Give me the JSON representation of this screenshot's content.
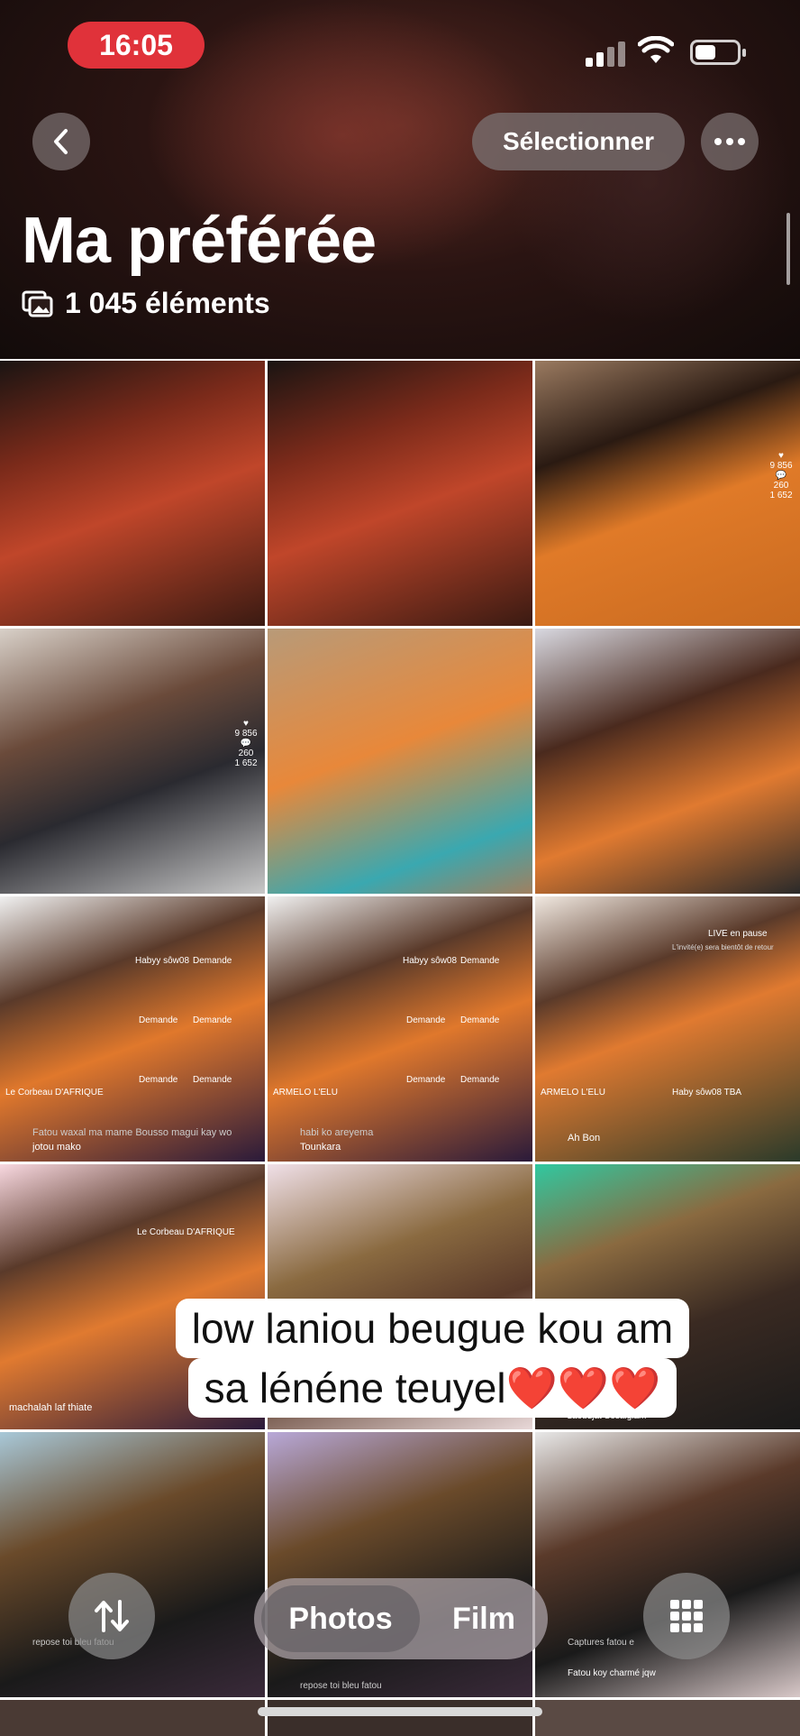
{
  "status_bar": {
    "time": "16:05"
  },
  "nav": {
    "back_icon": "chevron-left-icon",
    "select_label": "Sélectionner",
    "more_icon": "ellipsis-icon"
  },
  "album": {
    "title": "Ma préférée",
    "count_label": "1 045 éléments",
    "count_icon": "photos-stack-icon"
  },
  "grid": {
    "cells": [
      {
        "bg": "linear-gradient(160deg,#1a1412 0%,#7a2a1a 30%,#c0462a 55%,#3a1a12 100%)",
        "labels": []
      },
      {
        "bg": "linear-gradient(160deg,#1a1412 0%,#7a2a1a 30%,#c0462a 55%,#3a1a12 100%)",
        "labels": []
      },
      {
        "bg": "linear-gradient(160deg,#9a7a60 0%,#2a1a12 30%,#e07a28 55%,#c86a20 100%)",
        "labels": [
          "9 856",
          "260",
          "1 652"
        ]
      },
      {
        "bg": "linear-gradient(160deg,#d8d0c8 0%,#6a4a3a 35%,#2a2a30 60%,#c8c8c8 100%)",
        "labels": [
          "9 856",
          "260",
          "1 652"
        ]
      },
      {
        "bg": "linear-gradient(160deg,#b89a78 0%,#e8883a 45%,#3aa8b0 80%,#a08060 100%)",
        "labels": []
      },
      {
        "bg": "linear-gradient(160deg,#d8d8e0 0%,#4a2a1e 35%,#e07a30 65%,#2a2a2a 100%)",
        "labels": []
      },
      {
        "bg": "linear-gradient(160deg,#f0f0f0 0%,#5a3a2a 30%,#e0782c 55%,#2a1a3a 100%)",
        "labels": [
          "Le Corbeau D'AFRIQUE",
          "Habyy sôw08",
          "Demande",
          "Demande",
          "Demande",
          "Demande",
          "Demande",
          "Fatou waxal ma mame Bousso magui kay wo",
          "jotou mako"
        ]
      },
      {
        "bg": "linear-gradient(160deg,#f0f0f0 0%,#5a3a2a 30%,#e0782c 55%,#2a1a3a 100%)",
        "labels": [
          "ARMELO L'ELU",
          "Habyy sôw08",
          "Demande",
          "Demande",
          "Demande",
          "Demande",
          "Demande",
          "habi ko areyema",
          "Tounkara"
        ]
      },
      {
        "bg": "linear-gradient(160deg,#f0e8e0 0%,#5a3a2a 30%,#e07a30 50%,#2a3a2a 100%)",
        "labels": [
          "LIVE en pause",
          "L'invité(e) sera bientôt de retour",
          "ARMELO L'ELU",
          "Haby sôw08 TBA",
          "Ah Bon"
        ]
      },
      {
        "bg": "linear-gradient(160deg,#f8d8e0 0%,#5a3a2a 30%,#e07a30 55%,#2a1a3a 100%)",
        "labels": [
          "Le Corbeau D'AFRIQUE",
          "machalah laf thiate"
        ]
      },
      {
        "bg": "linear-gradient(160deg,#f0e0e8 0%,#8a6a40 35%,#5a3a2a 60%,#e8d8d8 100%)",
        "labels": []
      },
      {
        "bg": "linear-gradient(160deg,#30c8a0 0%,#8a6a40 30%,#3a2a22 60%,#1a1a1a 100%)",
        "labels": [
          "zaoudjat Sosaiglam"
        ]
      },
      {
        "bg": "linear-gradient(160deg,#a8c8d8 0%,#6a4a2a 35%,#1a1a1a 70%,#3a2a3a 100%)",
        "labels": [
          "repose toi bleu fatou"
        ]
      },
      {
        "bg": "linear-gradient(160deg,#b8a8d8 0%,#6a4a2a 35%,#1a1a1a 70%,#3a2a3a 100%)",
        "labels": [
          "repose toi bleu fatou"
        ]
      },
      {
        "bg": "linear-gradient(160deg,#e8e8e8 0%,#5a3a2a 35%,#1a1a1a 65%,#d8c8c8 100%)",
        "labels": [
          "Captures fatou e",
          "Fatou koy charmé jqw"
        ]
      }
    ]
  },
  "caption": {
    "line1": "low laniou beugue kou am",
    "line2": "sa lénéne teuyel❤️❤️❤️"
  },
  "bottom": {
    "sort_icon": "sort-arrows-icon",
    "photos_label": "Photos",
    "film_label": "Film",
    "grid_icon": "grid-view-icon"
  }
}
